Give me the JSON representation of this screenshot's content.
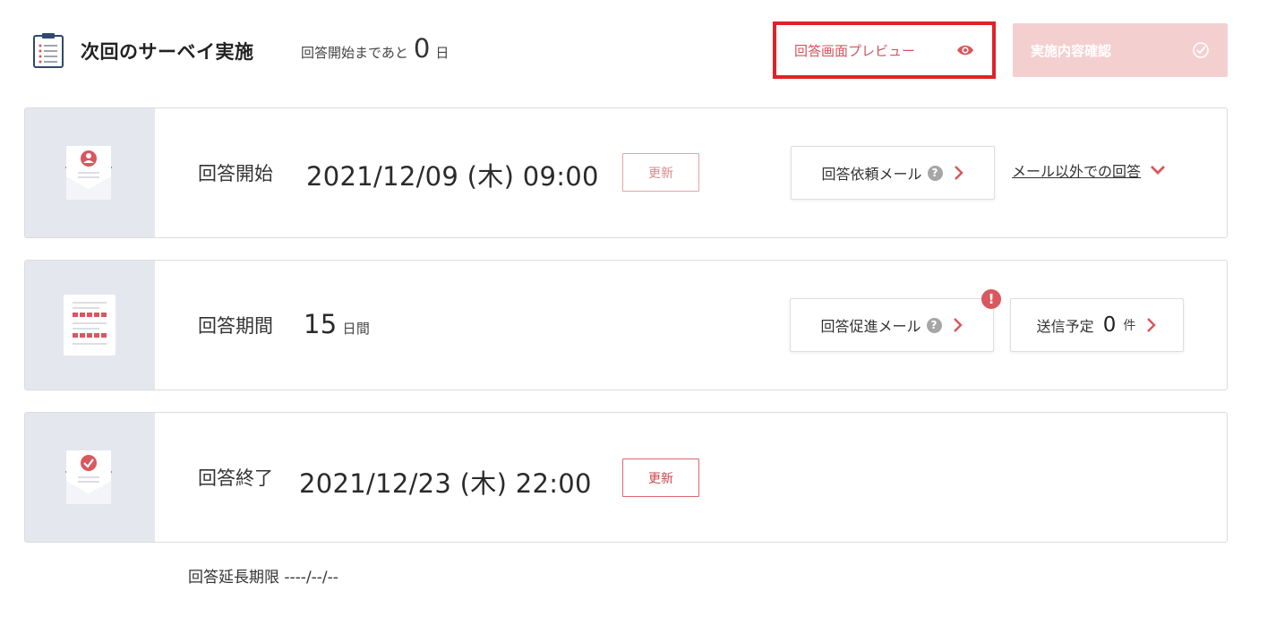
{
  "header": {
    "title": "次回のサーベイ実施",
    "countdown_prefix": "回答開始まであと",
    "countdown_value": "0",
    "countdown_unit": "日",
    "preview_button": "回答画面プレビュー",
    "confirm_button": "実施内容確認"
  },
  "start": {
    "label": "回答開始",
    "datetime": "2021/12/09 (木) 09:00",
    "update_button": "更新",
    "mail_button": "回答依頼メール",
    "other_link": "メール以外での回答"
  },
  "period": {
    "label": "回答期間",
    "value": "15",
    "unit": "日間",
    "reminder_button": "回答促進メール",
    "alert_mark": "!",
    "scheduled_label": "送信予定",
    "scheduled_count": "0",
    "scheduled_unit": "件"
  },
  "end": {
    "label": "回答終了",
    "datetime": "2021/12/23 (木) 22:00",
    "update_button": "更新"
  },
  "extension": {
    "text": "回答延長期限 ----/--/--"
  },
  "help_mark": "?",
  "colors": {
    "accent": "#d9575e",
    "highlight_border": "#e02228",
    "confirm_bg": "#f4cfd0",
    "side_panel": "#e4e7ee"
  }
}
